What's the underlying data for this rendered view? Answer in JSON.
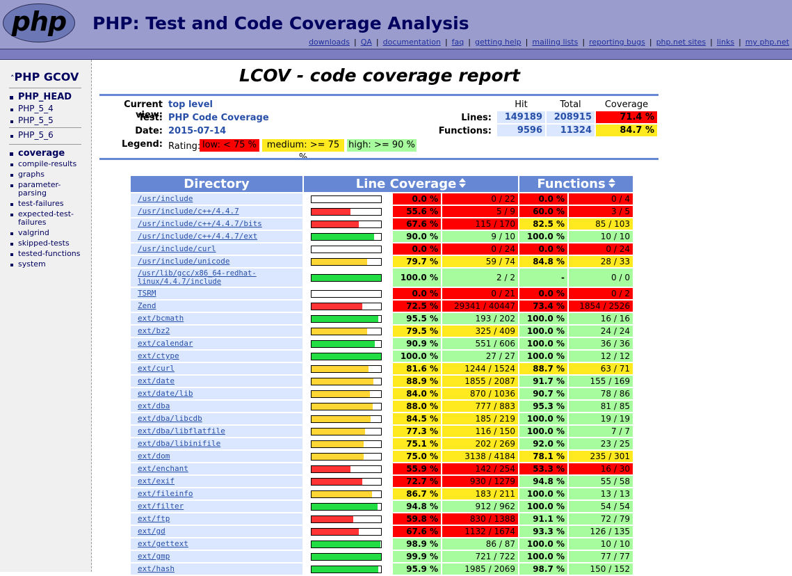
{
  "header": {
    "logo_text": "php",
    "title": "PHP: Test and Code Coverage Analysis",
    "nav": [
      "downloads",
      "QA",
      "documentation",
      "faq",
      "getting help",
      "mailing lists",
      "reporting bugs",
      "php.net sites",
      "links",
      "my php.net"
    ]
  },
  "sidebar": {
    "title": "PHP GCOV",
    "branches": [
      "PHP_HEAD",
      "PHP_5_4",
      "PHP_5_5",
      "PHP_5_6"
    ],
    "sections": [
      "coverage",
      "compile-results",
      "graphs",
      "parameter-parsing",
      "test-failures",
      "expected-test-failures",
      "valgrind",
      "skipped-tests",
      "tested-functions",
      "system"
    ]
  },
  "report": {
    "title": "LCOV - code coverage report",
    "current_view_label": "Current view:",
    "current_view": "top level",
    "test_label": "Test:",
    "test": "PHP Code Coverage",
    "date_label": "Date:",
    "date": "2015-07-14",
    "legend_label": "Legend:",
    "rating_label": "Rating:",
    "legend_low": "low: < 75 %",
    "legend_medium": "medium: >= 75 %",
    "legend_high": "high: >= 90 %",
    "col_hit": "Hit",
    "col_total": "Total",
    "col_coverage": "Coverage",
    "lines_label": "Lines:",
    "lines_hit": "149189",
    "lines_total": "208915",
    "lines_cov": "71.4 %",
    "functions_label": "Functions:",
    "functions_hit": "9596",
    "functions_total": "11324",
    "functions_cov": "84.7 %"
  },
  "colors": {
    "low": "#ff0000",
    "medium": "#ffea20",
    "high": "#a7fc9d",
    "bar_low": "#ff3333",
    "bar_medium": "#ffd633",
    "bar_high": "#22dd44",
    "header_blue": "#6688d4"
  },
  "table": {
    "headers": [
      "Directory",
      "Line Coverage",
      "Functions"
    ],
    "rows": [
      {
        "dir": "/usr/include",
        "pct": "0.0 %",
        "lines": "0 / 22",
        "fpct": "0.0 %",
        "funcs": "0 / 4",
        "bar": 0,
        "lr": "low",
        "fr": "low"
      },
      {
        "dir": "/usr/include/c++/4.4.7",
        "pct": "55.6 %",
        "lines": "5 / 9",
        "fpct": "60.0 %",
        "funcs": "3 / 5",
        "bar": 55.6,
        "lr": "low",
        "fr": "low"
      },
      {
        "dir": "/usr/include/c++/4.4.7/bits",
        "pct": "67.6 %",
        "lines": "115 / 170",
        "fpct": "82.5 %",
        "funcs": "85 / 103",
        "bar": 67.6,
        "lr": "low",
        "fr": "medium"
      },
      {
        "dir": "/usr/include/c++/4.4.7/ext",
        "pct": "90.0 %",
        "lines": "9 / 10",
        "fpct": "100.0 %",
        "funcs": "10 / 10",
        "bar": 90.0,
        "lr": "high",
        "fr": "high"
      },
      {
        "dir": "/usr/include/curl",
        "pct": "0.0 %",
        "lines": "0 / 24",
        "fpct": "0.0 %",
        "funcs": "0 / 24",
        "bar": 0,
        "lr": "low",
        "fr": "low"
      },
      {
        "dir": "/usr/include/unicode",
        "pct": "79.7 %",
        "lines": "59 / 74",
        "fpct": "84.8 %",
        "funcs": "28 / 33",
        "bar": 79.7,
        "lr": "medium",
        "fr": "medium"
      },
      {
        "dir": "/usr/lib/gcc/x86_64-redhat-linux/4.4.7/include",
        "dir1": "/usr/lib/gcc/x86_64-redhat-",
        "dir2": "linux/4.4.7/include",
        "pct": "100.0 %",
        "lines": "2 / 2",
        "fpct": "-",
        "funcs": "0 / 0",
        "bar": 100,
        "lr": "high",
        "fr": "high"
      },
      {
        "dir": "TSRM",
        "pct": "0.0 %",
        "lines": "0 / 21",
        "fpct": "0.0 %",
        "funcs": "0 / 2",
        "bar": 0,
        "lr": "low",
        "fr": "low"
      },
      {
        "dir": "Zend",
        "pct": "72.5 %",
        "lines": "29341 / 40447",
        "fpct": "73.4 %",
        "funcs": "1854 / 2526",
        "bar": 72.5,
        "lr": "low",
        "fr": "low"
      },
      {
        "dir": "ext/bcmath",
        "pct": "95.5 %",
        "lines": "193 / 202",
        "fpct": "100.0 %",
        "funcs": "16 / 16",
        "bar": 95.5,
        "lr": "high",
        "fr": "high"
      },
      {
        "dir": "ext/bz2",
        "pct": "79.5 %",
        "lines": "325 / 409",
        "fpct": "100.0 %",
        "funcs": "24 / 24",
        "bar": 79.5,
        "lr": "medium",
        "fr": "high"
      },
      {
        "dir": "ext/calendar",
        "pct": "90.9 %",
        "lines": "551 / 606",
        "fpct": "100.0 %",
        "funcs": "36 / 36",
        "bar": 90.9,
        "lr": "high",
        "fr": "high"
      },
      {
        "dir": "ext/ctype",
        "pct": "100.0 %",
        "lines": "27 / 27",
        "fpct": "100.0 %",
        "funcs": "12 / 12",
        "bar": 100,
        "lr": "high",
        "fr": "high"
      },
      {
        "dir": "ext/curl",
        "pct": "81.6 %",
        "lines": "1244 / 1524",
        "fpct": "88.7 %",
        "funcs": "63 / 71",
        "bar": 81.6,
        "lr": "medium",
        "fr": "medium"
      },
      {
        "dir": "ext/date",
        "pct": "88.9 %",
        "lines": "1855 / 2087",
        "fpct": "91.7 %",
        "funcs": "155 / 169",
        "bar": 88.9,
        "lr": "medium",
        "fr": "high"
      },
      {
        "dir": "ext/date/lib",
        "pct": "84.0 %",
        "lines": "870 / 1036",
        "fpct": "90.7 %",
        "funcs": "78 / 86",
        "bar": 84.0,
        "lr": "medium",
        "fr": "high"
      },
      {
        "dir": "ext/dba",
        "pct": "88.0 %",
        "lines": "777 / 883",
        "fpct": "95.3 %",
        "funcs": "81 / 85",
        "bar": 88.0,
        "lr": "medium",
        "fr": "high"
      },
      {
        "dir": "ext/dba/libcdb",
        "pct": "84.5 %",
        "lines": "185 / 219",
        "fpct": "100.0 %",
        "funcs": "19 / 19",
        "bar": 84.5,
        "lr": "medium",
        "fr": "high"
      },
      {
        "dir": "ext/dba/libflatfile",
        "pct": "77.3 %",
        "lines": "116 / 150",
        "fpct": "100.0 %",
        "funcs": "7 / 7",
        "bar": 77.3,
        "lr": "medium",
        "fr": "high"
      },
      {
        "dir": "ext/dba/libinifile",
        "pct": "75.1 %",
        "lines": "202 / 269",
        "fpct": "92.0 %",
        "funcs": "23 / 25",
        "bar": 75.1,
        "lr": "medium",
        "fr": "high"
      },
      {
        "dir": "ext/dom",
        "pct": "75.0 %",
        "lines": "3138 / 4184",
        "fpct": "78.1 %",
        "funcs": "235 / 301",
        "bar": 75.0,
        "lr": "medium",
        "fr": "medium"
      },
      {
        "dir": "ext/enchant",
        "pct": "55.9 %",
        "lines": "142 / 254",
        "fpct": "53.3 %",
        "funcs": "16 / 30",
        "bar": 55.9,
        "lr": "low",
        "fr": "low"
      },
      {
        "dir": "ext/exif",
        "pct": "72.7 %",
        "lines": "930 / 1279",
        "fpct": "94.8 %",
        "funcs": "55 / 58",
        "bar": 72.7,
        "lr": "low",
        "fr": "high"
      },
      {
        "dir": "ext/fileinfo",
        "pct": "86.7 %",
        "lines": "183 / 211",
        "fpct": "100.0 %",
        "funcs": "13 / 13",
        "bar": 86.7,
        "lr": "medium",
        "fr": "high"
      },
      {
        "dir": "ext/filter",
        "pct": "94.8 %",
        "lines": "912 / 962",
        "fpct": "100.0 %",
        "funcs": "54 / 54",
        "bar": 94.8,
        "lr": "high",
        "fr": "high"
      },
      {
        "dir": "ext/ftp",
        "pct": "59.8 %",
        "lines": "830 / 1388",
        "fpct": "91.1 %",
        "funcs": "72 / 79",
        "bar": 59.8,
        "lr": "low",
        "fr": "high"
      },
      {
        "dir": "ext/gd",
        "pct": "67.6 %",
        "lines": "1132 / 1674",
        "fpct": "93.3 %",
        "funcs": "126 / 135",
        "bar": 67.6,
        "lr": "low",
        "fr": "high"
      },
      {
        "dir": "ext/gettext",
        "pct": "98.9 %",
        "lines": "86 / 87",
        "fpct": "100.0 %",
        "funcs": "10 / 10",
        "bar": 98.9,
        "lr": "high",
        "fr": "high"
      },
      {
        "dir": "ext/gmp",
        "pct": "99.9 %",
        "lines": "721 / 722",
        "fpct": "100.0 %",
        "funcs": "77 / 77",
        "bar": 99.9,
        "lr": "high",
        "fr": "high"
      },
      {
        "dir": "ext/hash",
        "pct": "95.9 %",
        "lines": "1985 / 2069",
        "fpct": "98.7 %",
        "funcs": "150 / 152",
        "bar": 95.9,
        "lr": "high",
        "fr": "high"
      }
    ]
  }
}
